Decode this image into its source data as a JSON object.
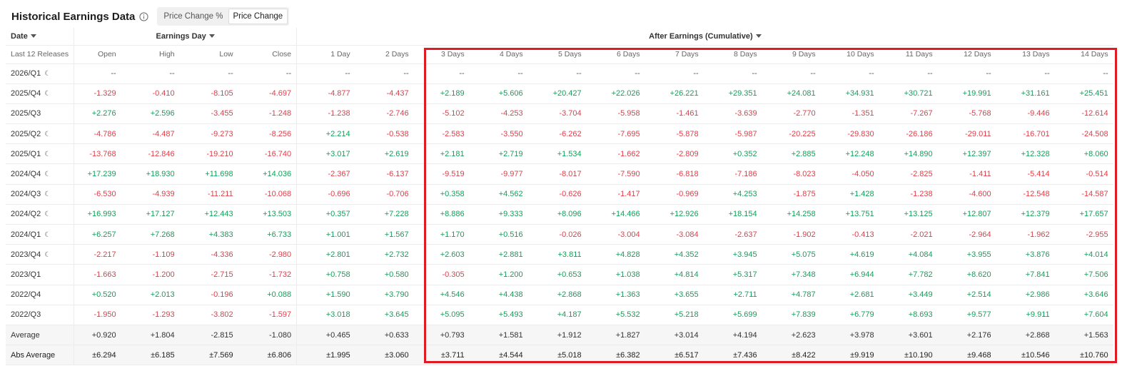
{
  "header": {
    "title": "Historical Earnings Data",
    "toggle": [
      {
        "label": "Price Change %",
        "active": false
      },
      {
        "label": "Price Change",
        "active": true
      }
    ]
  },
  "groups": {
    "date": "Date",
    "earnings_day": "Earnings Day",
    "after_earnings": "After Earnings (Cumulative)"
  },
  "columns": [
    "Last 12 Releases",
    "Open",
    "High",
    "Low",
    "Close",
    "1 Day",
    "2 Days",
    "3 Days",
    "4 Days",
    "5 Days",
    "6 Days",
    "7 Days",
    "8 Days",
    "9 Days",
    "10 Days",
    "11 Days",
    "12 Days",
    "13 Days",
    "14 Days"
  ],
  "rows": [
    {
      "period": "2026/Q1",
      "moon": true,
      "values": [
        "--",
        "--",
        "--",
        "--",
        "--",
        "--",
        "--",
        "--",
        "--",
        "--",
        "--",
        "--",
        "--",
        "--",
        "--",
        "--",
        "--",
        "--"
      ]
    },
    {
      "period": "2025/Q4",
      "moon": true,
      "values": [
        "-1.329",
        "-0.410",
        "-8.105",
        "-4.697",
        "-4.877",
        "-4.437",
        "+2.189",
        "+5.606",
        "+20.427",
        "+22.026",
        "+26.221",
        "+29.351",
        "+24.081",
        "+34.931",
        "+30.721",
        "+19.991",
        "+31.161",
        "+25.451"
      ]
    },
    {
      "period": "2025/Q3",
      "moon": false,
      "values": [
        "+2.276",
        "+2.596",
        "-3.455",
        "-1.248",
        "-1.238",
        "-2.746",
        "-5.102",
        "-4.253",
        "-3.704",
        "-5.958",
        "-1.461",
        "-3.639",
        "-2.770",
        "-1.351",
        "-7.267",
        "-5.768",
        "-9.446",
        "-12.614"
      ]
    },
    {
      "period": "2025/Q2",
      "moon": true,
      "values": [
        "-4.786",
        "-4.487",
        "-9.273",
        "-8.256",
        "+2.214",
        "-0.538",
        "-2.583",
        "-3.550",
        "-6.262",
        "-7.695",
        "-5.878",
        "-5.987",
        "-20.225",
        "-29.830",
        "-26.186",
        "-29.011",
        "-16.701",
        "-24.508"
      ]
    },
    {
      "period": "2025/Q1",
      "moon": true,
      "values": [
        "-13.768",
        "-12.846",
        "-19.210",
        "-16.740",
        "+3.017",
        "+2.619",
        "+2.181",
        "+2.719",
        "+1.534",
        "-1.662",
        "-2.809",
        "+0.352",
        "+2.885",
        "+12.248",
        "+14.890",
        "+12.397",
        "+12.328",
        "+8.060"
      ]
    },
    {
      "period": "2024/Q4",
      "moon": true,
      "values": [
        "+17.239",
        "+18.930",
        "+11.698",
        "+14.036",
        "-2.367",
        "-6.137",
        "-9.519",
        "-9.977",
        "-8.017",
        "-7.590",
        "-6.818",
        "-7.186",
        "-8.023",
        "-4.050",
        "-2.825",
        "-1.411",
        "-5.414",
        "-0.514"
      ]
    },
    {
      "period": "2024/Q3",
      "moon": true,
      "values": [
        "-6.530",
        "-4.939",
        "-11.211",
        "-10.068",
        "-0.696",
        "-0.706",
        "+0.358",
        "+4.562",
        "-0.626",
        "-1.417",
        "-0.969",
        "+4.253",
        "-1.875",
        "+1.428",
        "-1.238",
        "-4.600",
        "-12.548",
        "-14.587"
      ]
    },
    {
      "period": "2024/Q2",
      "moon": true,
      "values": [
        "+16.993",
        "+17.127",
        "+12.443",
        "+13.503",
        "+0.357",
        "+7.228",
        "+8.886",
        "+9.333",
        "+8.096",
        "+14.466",
        "+12.926",
        "+18.154",
        "+14.258",
        "+13.751",
        "+13.125",
        "+12.807",
        "+12.379",
        "+17.657"
      ]
    },
    {
      "period": "2024/Q1",
      "moon": true,
      "values": [
        "+6.257",
        "+7.268",
        "+4.383",
        "+6.733",
        "+1.001",
        "+1.567",
        "+1.170",
        "+0.516",
        "-0.026",
        "-3.004",
        "-3.084",
        "-2.637",
        "-1.902",
        "-0.413",
        "-2.021",
        "-2.964",
        "-1.962",
        "-2.955"
      ]
    },
    {
      "period": "2023/Q4",
      "moon": true,
      "values": [
        "-2.217",
        "-1.109",
        "-4.336",
        "-2.980",
        "+2.801",
        "+2.732",
        "+2.603",
        "+2.881",
        "+3.811",
        "+4.828",
        "+4.352",
        "+3.945",
        "+5.075",
        "+4.619",
        "+4.084",
        "+3.955",
        "+3.876",
        "+4.014"
      ]
    },
    {
      "period": "2023/Q1",
      "moon": false,
      "values": [
        "-1.663",
        "-1.200",
        "-2.715",
        "-1.732",
        "+0.758",
        "+0.580",
        "-0.305",
        "+1.200",
        "+0.653",
        "+1.038",
        "+4.814",
        "+5.317",
        "+7.348",
        "+6.944",
        "+7.782",
        "+8.620",
        "+7.841",
        "+7.506"
      ]
    },
    {
      "period": "2022/Q4",
      "moon": false,
      "values": [
        "+0.520",
        "+2.013",
        "-0.196",
        "+0.088",
        "+1.590",
        "+3.790",
        "+4.546",
        "+4.438",
        "+2.868",
        "+1.363",
        "+3.655",
        "+2.711",
        "+4.787",
        "+2.681",
        "+3.449",
        "+2.514",
        "+2.986",
        "+3.646"
      ]
    },
    {
      "period": "2022/Q3",
      "moon": false,
      "values": [
        "-1.950",
        "-1.293",
        "-3.802",
        "-1.597",
        "+3.018",
        "+3.645",
        "+5.095",
        "+5.493",
        "+4.187",
        "+5.532",
        "+5.218",
        "+5.699",
        "+7.839",
        "+6.779",
        "+8.693",
        "+9.577",
        "+9.911",
        "+7.604"
      ]
    }
  ],
  "summary": [
    {
      "label": "Average",
      "values": [
        "+0.920",
        "+1.804",
        "-2.815",
        "-1.080",
        "+0.465",
        "+0.633",
        "+0.793",
        "+1.581",
        "+1.912",
        "+1.827",
        "+3.014",
        "+4.194",
        "+2.623",
        "+3.978",
        "+3.601",
        "+2.176",
        "+2.868",
        "+1.563"
      ]
    },
    {
      "label": "Abs Average",
      "values": [
        "±6.294",
        "±6.185",
        "±7.569",
        "±6.806",
        "±1.995",
        "±3.060",
        "±3.711",
        "±4.544",
        "±5.018",
        "±6.382",
        "±6.517",
        "±7.436",
        "±8.422",
        "±9.919",
        "±10.190",
        "±9.468",
        "±10.546",
        "±10.760"
      ]
    }
  ],
  "colors": {
    "positive": "#13a05a",
    "negative": "#e23d48",
    "highlight": "#e01b24"
  }
}
